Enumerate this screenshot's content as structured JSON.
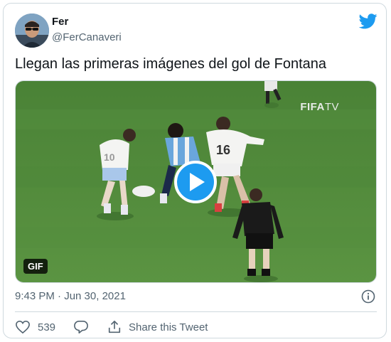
{
  "tweet": {
    "author_name": "Fer",
    "author_handle": "@FerCanaveri",
    "text": "Llegan las primeras imágenes del gol de Fontana",
    "timestamp": "9:43 PM · Jun 30, 2021",
    "media": {
      "watermark_main": "FIFA",
      "watermark_sub": "TV",
      "badge": "GIF"
    }
  },
  "actions": {
    "like_count": "539",
    "share_label": "Share this Tweet"
  },
  "colors": {
    "accent": "#1d9bf0",
    "text_primary": "#0f1419",
    "text_secondary": "#536471",
    "border": "#cfd9de",
    "pitch": "#4f8a3a"
  },
  "icons": [
    "twitter-bird-icon",
    "play-icon",
    "info-icon",
    "heart-icon",
    "reply-bubble-icon",
    "share-icon"
  ]
}
